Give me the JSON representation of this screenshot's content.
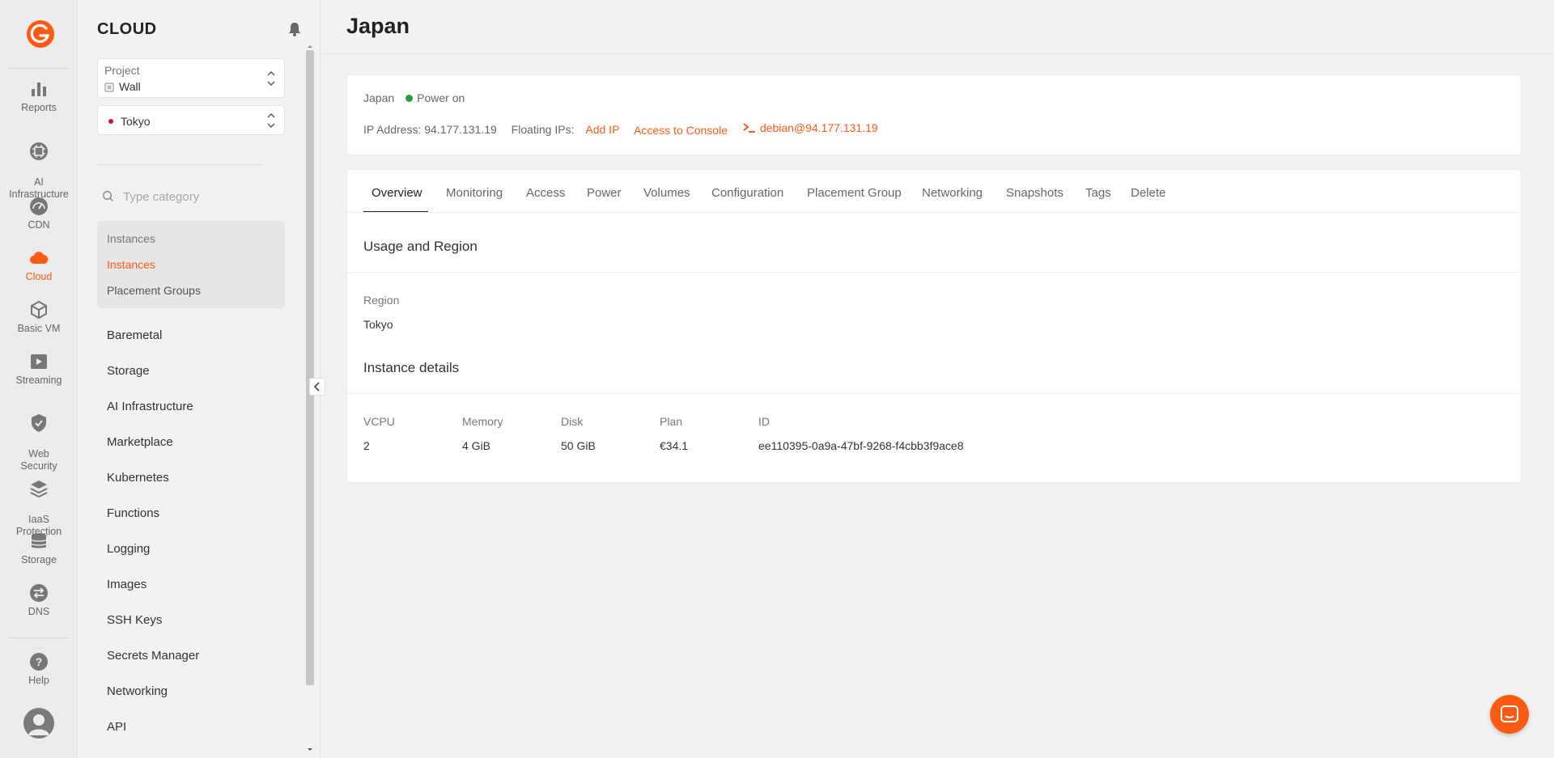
{
  "rail": {
    "items": [
      {
        "label": "Reports",
        "icon": "chart-bar-icon"
      },
      {
        "label": "AI\nInfrastructure",
        "icon": "chip-icon"
      },
      {
        "label": "CDN",
        "icon": "speedometer-icon"
      },
      {
        "label": "Cloud",
        "icon": "cloud-icon",
        "active": true
      },
      {
        "label": "Basic VM",
        "icon": "cube-icon"
      },
      {
        "label": "Streaming",
        "icon": "play-icon"
      },
      {
        "label": "Web\nSecurity",
        "icon": "shield-icon"
      },
      {
        "label": "IaaS\nProtection",
        "icon": "layers-icon"
      },
      {
        "label": "Storage",
        "icon": "database-icon"
      },
      {
        "label": "DNS",
        "icon": "arrows-swap-icon"
      }
    ],
    "help_label": "Help"
  },
  "sidebar": {
    "title": "CLOUD",
    "project": {
      "label": "Project",
      "value": "Wall"
    },
    "region": {
      "value": "Tokyo"
    },
    "search_placeholder": "Type category",
    "group": {
      "header": "Instances",
      "active": "Instances",
      "item": "Placement Groups"
    },
    "nav": [
      "Baremetal",
      "Storage",
      "AI Infrastructure",
      "Marketplace",
      "Kubernetes",
      "Functions",
      "Logging",
      "Images",
      "SSH Keys",
      "Secrets Manager",
      "Networking",
      "API"
    ]
  },
  "main": {
    "title": "Japan",
    "summary": {
      "name": "Japan",
      "status": "Power on",
      "ip_label": "IP Address: 94.177.131.19",
      "floating_label": "Floating IPs:",
      "add_ip": "Add IP",
      "console": "Access to Console",
      "ssh": "debian@94.177.131.19"
    },
    "tabs": [
      "Overview",
      "Monitoring",
      "Access",
      "Power",
      "Volumes",
      "Configuration",
      "Placement Group",
      "Networking",
      "Snapshots",
      "Tags",
      "Delete"
    ],
    "usage": {
      "title": "Usage and Region",
      "region_label": "Region",
      "region_value": "Tokyo"
    },
    "details": {
      "title": "Instance details",
      "vcpu_label": "VCPU",
      "vcpu": "2",
      "memory_label": "Memory",
      "memory": "4 GiB",
      "disk_label": "Disk",
      "disk": "50 GiB",
      "plan_label": "Plan",
      "plan": "€34.1",
      "id_label": "ID",
      "id": "ee110395-0a9a-47bf-9268-f4cbb3f9ace8"
    }
  },
  "colors": {
    "accent": "#ff5a14",
    "status_green": "#2c9c3c"
  }
}
